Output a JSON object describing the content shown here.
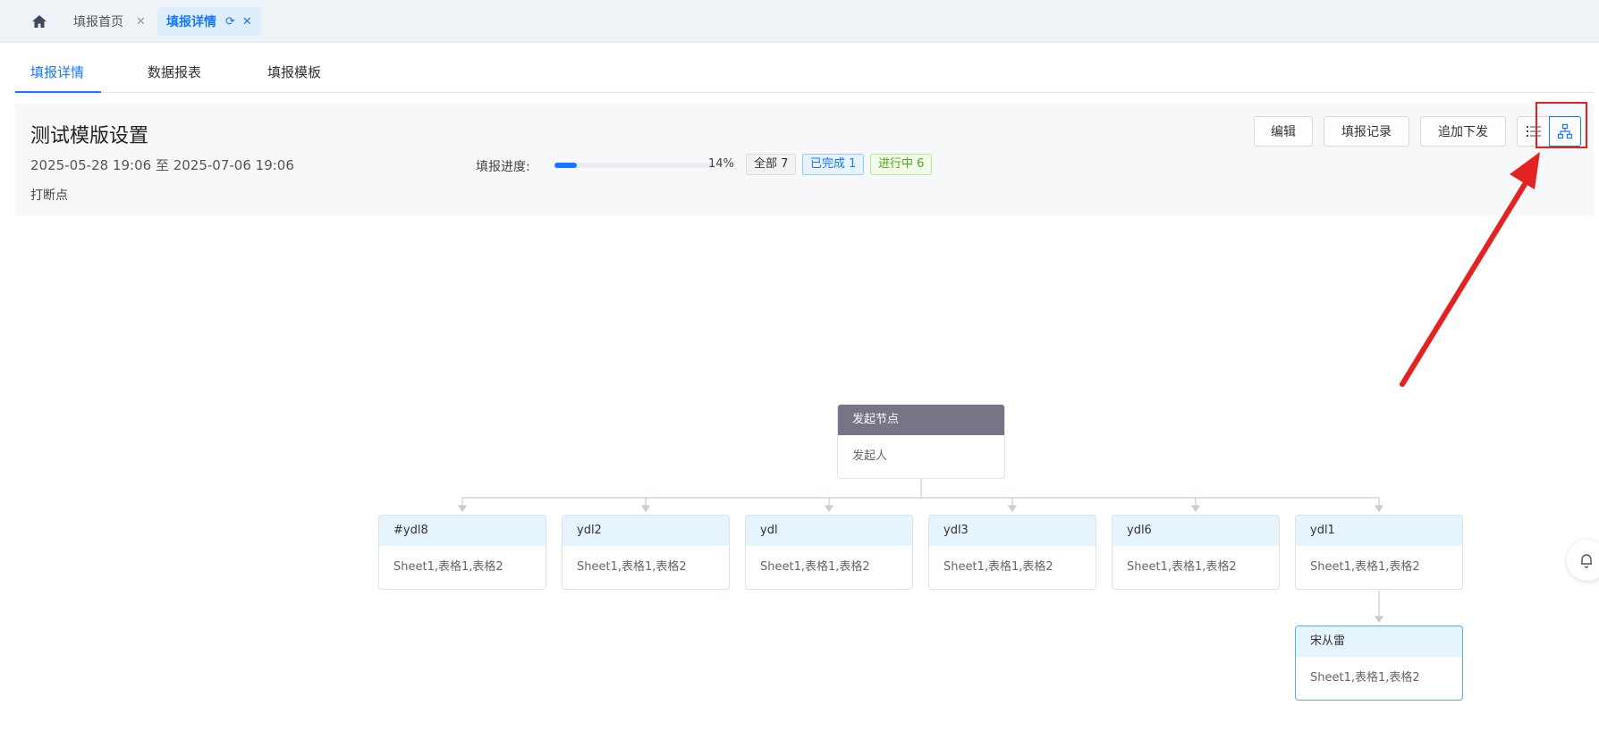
{
  "tabbar": {
    "tabs": [
      {
        "label": "填报首页"
      },
      {
        "label": "填报详情"
      }
    ]
  },
  "subtabs": [
    "填报详情",
    "数据报表",
    "填报模板"
  ],
  "header": {
    "title": "测试模版设置",
    "date_range": "2025-05-28 19:06 至 2025-07-06 19:06",
    "description": "打断点",
    "progress_label": "填报进度:",
    "progress_value": 0.14,
    "progress_text": "14%",
    "badges": {
      "all": "全部 7",
      "done": "已完成 1",
      "in_progress": "进行中 6"
    },
    "buttons": {
      "edit": "编辑",
      "records": "填报记录",
      "append": "追加下发"
    }
  },
  "flow": {
    "root": {
      "title": "发起节点",
      "body": "发起人"
    },
    "children": [
      {
        "title": "#ydl8",
        "body": "Sheet1,表格1,表格2"
      },
      {
        "title": "ydl2",
        "body": "Sheet1,表格1,表格2"
      },
      {
        "title": "ydl",
        "body": "Sheet1,表格1,表格2"
      },
      {
        "title": "ydl3",
        "body": "Sheet1,表格1,表格2"
      },
      {
        "title": "ydl6",
        "body": "Sheet1,表格1,表格2"
      },
      {
        "title": "ydl1",
        "body": "Sheet1,表格1,表格2"
      }
    ],
    "grandchild": {
      "title": "宋从雷",
      "body": "Sheet1,表格1,表格2"
    }
  },
  "colors": {
    "primary": "#1677ff",
    "root_header": "#787486",
    "node_header": "#e6f4fd",
    "annotation": "#e52222"
  }
}
